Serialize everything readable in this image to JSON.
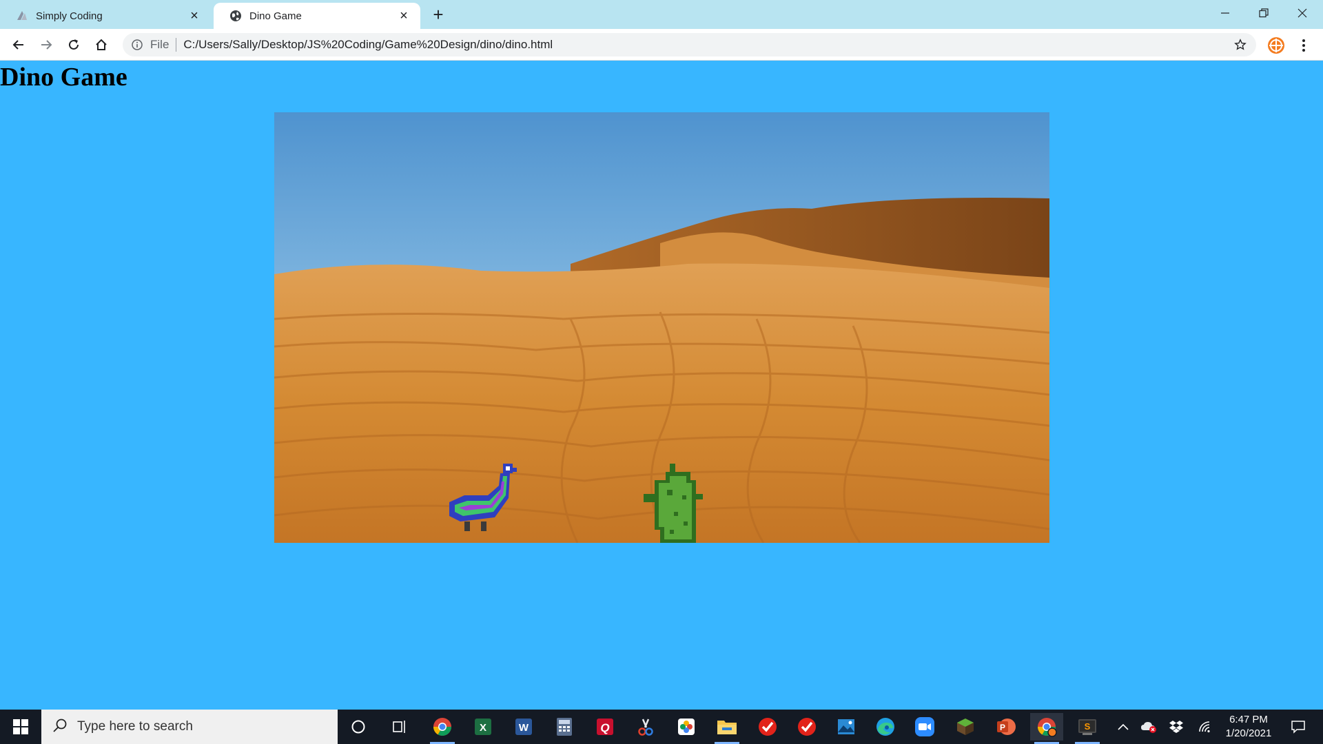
{
  "browser": {
    "tabs": [
      {
        "title": "Simply Coding",
        "active": false,
        "icon": "simply-coding-favicon"
      },
      {
        "title": "Dino Game",
        "active": true,
        "icon": "globe-icon"
      }
    ],
    "new_tab_label": "+",
    "address": {
      "scheme_label": "File",
      "url": "C:/Users/Sally/Desktop/JS%20Coding/Game%20Design/dino/dino.html"
    }
  },
  "page": {
    "heading": "Dino Game",
    "background_color": "#38b6ff",
    "game": {
      "background": "desert-sand-dunes",
      "sprites": [
        "bird-sprite",
        "dino-sprite"
      ]
    }
  },
  "taskbar": {
    "search_placeholder": "Type here to search",
    "apps": [
      "cortana-icon",
      "task-view-icon",
      "chrome-icon",
      "excel-icon",
      "word-icon",
      "calculator-icon",
      "q-app-icon",
      "snip-icon",
      "photos-icon",
      "file-explorer-icon",
      "todo-icon",
      "todo-alt-icon",
      "photos-viewer-icon",
      "edge-icon",
      "zoom-icon",
      "minecraft-icon",
      "powerpoint-icon",
      "chrome-profile-icon",
      "sublime-icon"
    ],
    "clock": {
      "time": "6:47 PM",
      "date": "1/20/2021"
    }
  }
}
